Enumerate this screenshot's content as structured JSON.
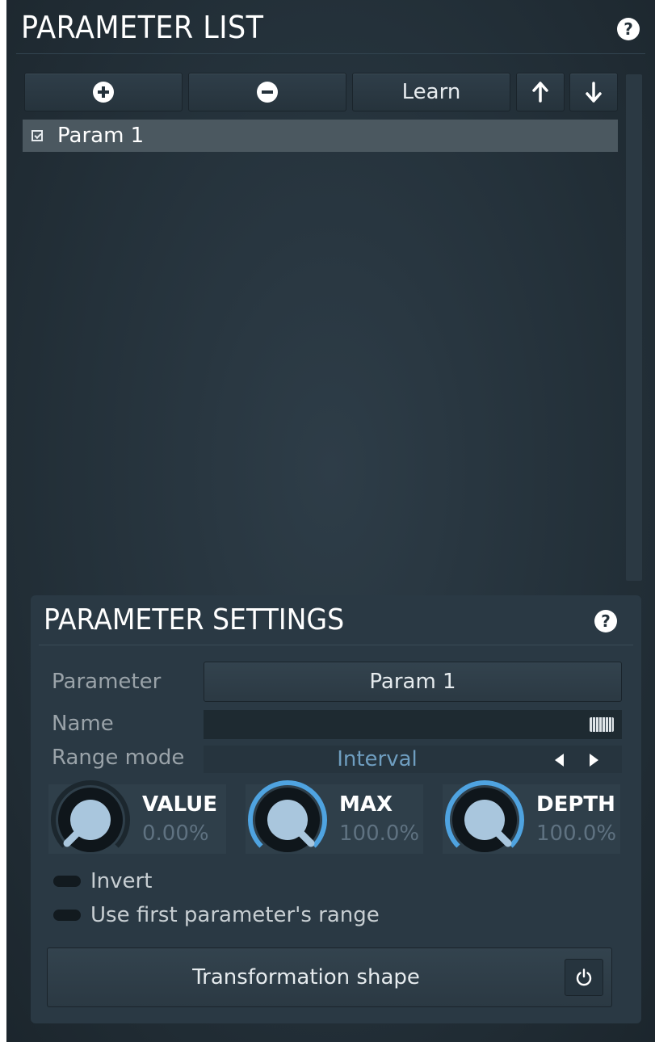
{
  "parameter_list": {
    "title": "PARAMETER LIST",
    "help_label": "?",
    "toolbar": {
      "add_icon": "plus-circle-icon",
      "remove_icon": "minus-circle-icon",
      "learn_label": "Learn",
      "up_icon": "arrow-up-icon",
      "down_icon": "arrow-down-icon"
    },
    "items": [
      {
        "label": "Param 1",
        "checked": true
      }
    ]
  },
  "parameter_settings": {
    "title": "PARAMETER SETTINGS",
    "help_label": "?",
    "parameter_label": "Parameter",
    "parameter_value": "Param 1",
    "name_label": "Name",
    "name_value": "",
    "range_mode_label": "Range mode",
    "range_mode_value": "Interval",
    "knobs": [
      {
        "title": "VALUE",
        "value": "0.00%",
        "fraction": 0.0
      },
      {
        "title": "MAX",
        "value": "100.0%",
        "fraction": 1.0
      },
      {
        "title": "DEPTH",
        "value": "100.0%",
        "fraction": 1.0
      }
    ],
    "invert_label": "Invert",
    "use_first_range_label": "Use first parameter's range",
    "transformation_label": "Transformation shape",
    "power_icon": "power-icon"
  },
  "colors": {
    "background": "#24313a",
    "accent_blue": "#4fa3e0",
    "knob_face": "#a9c6dd",
    "value_text": "#6f9ec0"
  }
}
